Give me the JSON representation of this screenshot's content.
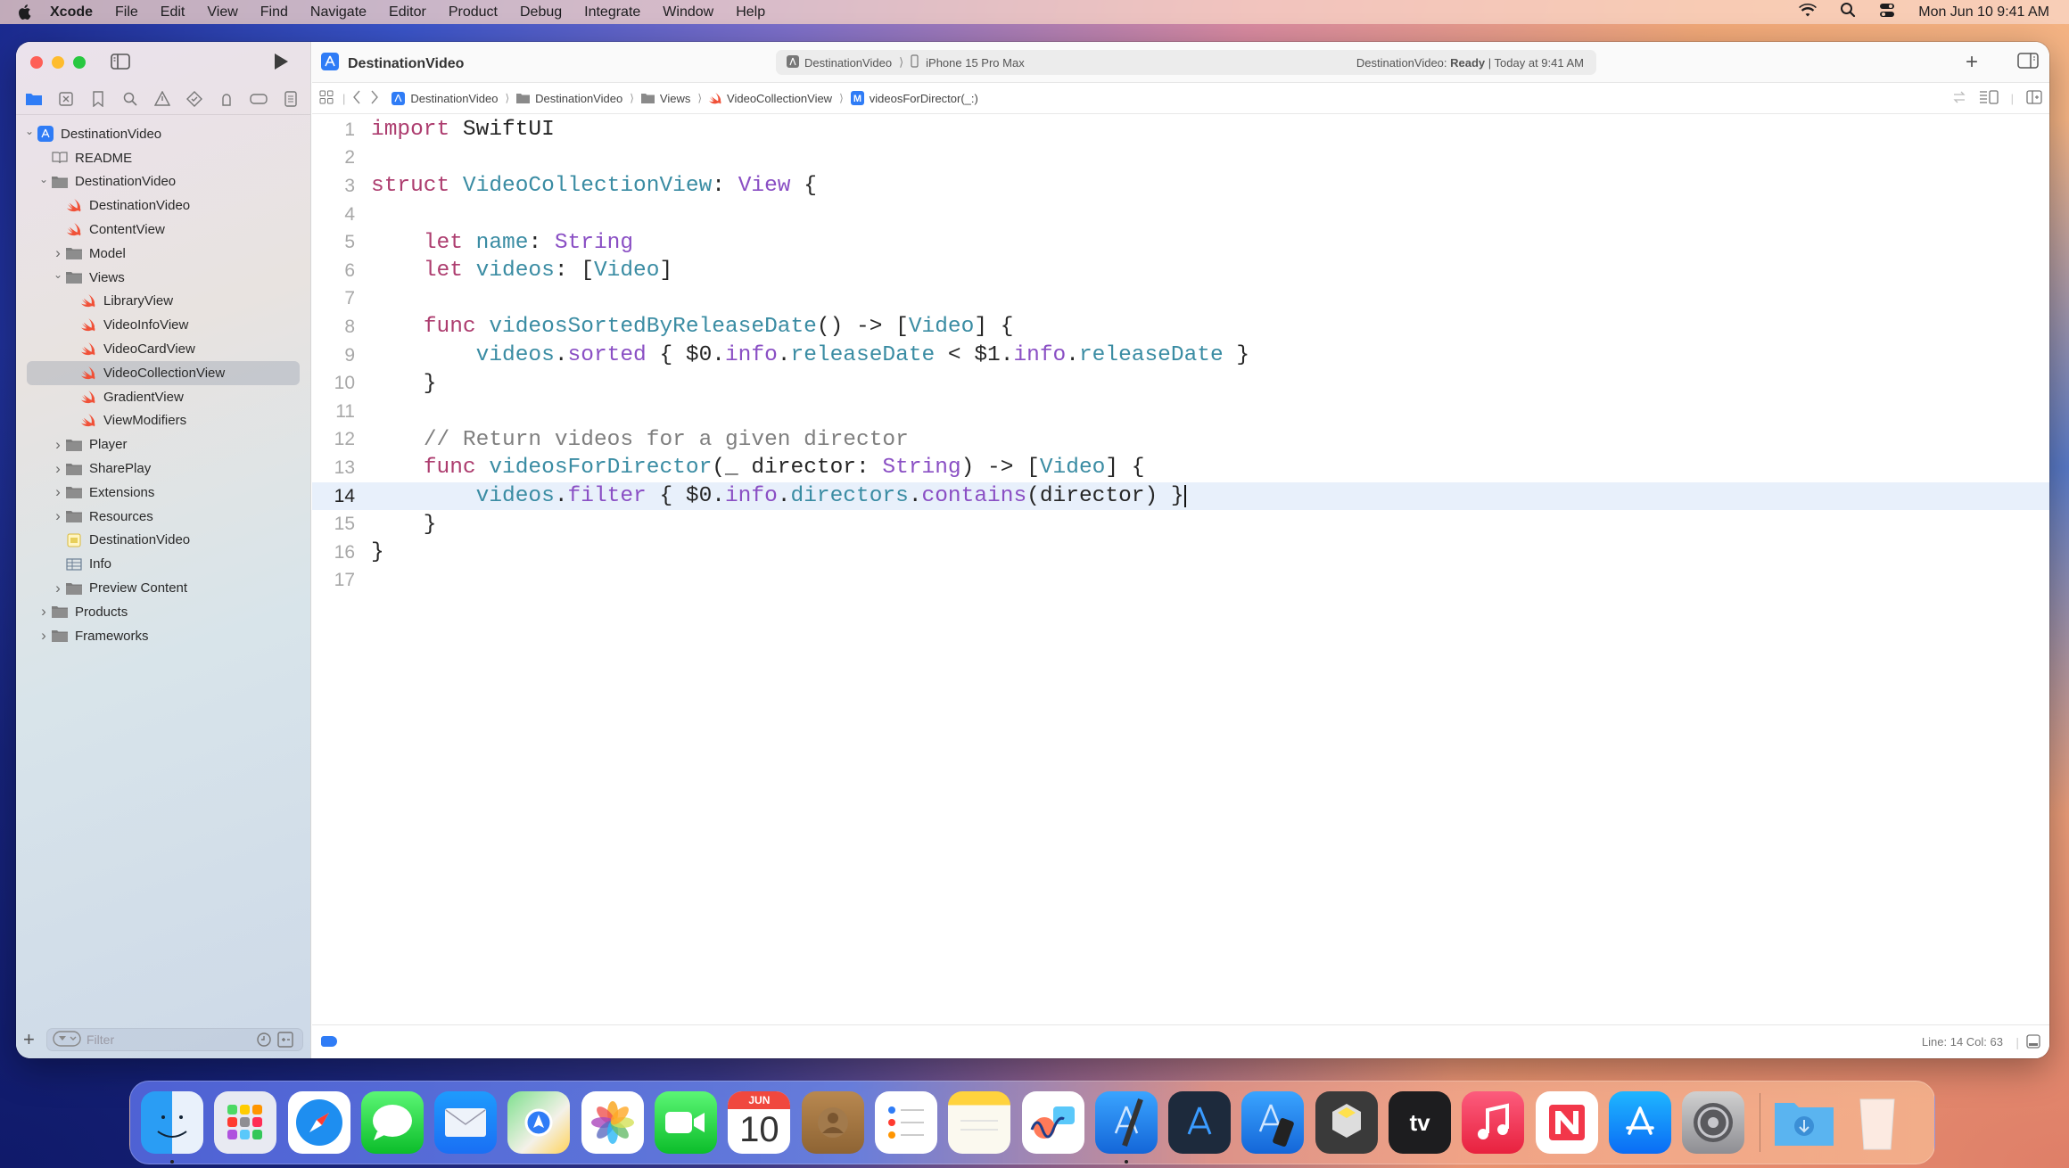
{
  "menubar": {
    "app_name": "Xcode",
    "items": [
      "File",
      "Edit",
      "View",
      "Find",
      "Navigate",
      "Editor",
      "Product",
      "Debug",
      "Integrate",
      "Window",
      "Help"
    ],
    "clock": "Mon Jun 10  9:41 AM"
  },
  "window": {
    "title": "DestinationVideo",
    "scheme": {
      "project": "DestinationVideo",
      "device": "iPhone 15 Pro Max",
      "status_prefix": "DestinationVideo: ",
      "status_bold": "Ready",
      "status_suffix": " | Today at 9:41 AM"
    },
    "breadcrumb": [
      "DestinationVideo",
      "DestinationVideo",
      "Views",
      "VideoCollectionView",
      "videosForDirector(_:)"
    ]
  },
  "navigator": {
    "tree": [
      {
        "label": "DestinationVideo",
        "depth": 0,
        "type": "project",
        "chevron": "open"
      },
      {
        "label": "README",
        "depth": 1,
        "type": "book",
        "chevron": "none"
      },
      {
        "label": "DestinationVideo",
        "depth": 1,
        "type": "folder",
        "chevron": "open"
      },
      {
        "label": "DestinationVideo",
        "depth": 2,
        "type": "swift",
        "chevron": "none"
      },
      {
        "label": "ContentView",
        "depth": 2,
        "type": "swift",
        "chevron": "none"
      },
      {
        "label": "Model",
        "depth": 2,
        "type": "folder",
        "chevron": "closed"
      },
      {
        "label": "Views",
        "depth": 2,
        "type": "folder",
        "chevron": "open"
      },
      {
        "label": "LibraryView",
        "depth": 3,
        "type": "swift",
        "chevron": "none"
      },
      {
        "label": "VideoInfoView",
        "depth": 3,
        "type": "swift",
        "chevron": "none"
      },
      {
        "label": "VideoCardView",
        "depth": 3,
        "type": "swift",
        "chevron": "none"
      },
      {
        "label": "VideoCollectionView",
        "depth": 3,
        "type": "swift",
        "chevron": "none",
        "selected": true
      },
      {
        "label": "GradientView",
        "depth": 3,
        "type": "swift",
        "chevron": "none"
      },
      {
        "label": "ViewModifiers",
        "depth": 3,
        "type": "swift",
        "chevron": "none"
      },
      {
        "label": "Player",
        "depth": 2,
        "type": "folder",
        "chevron": "closed"
      },
      {
        "label": "SharePlay",
        "depth": 2,
        "type": "folder",
        "chevron": "closed"
      },
      {
        "label": "Extensions",
        "depth": 2,
        "type": "folder",
        "chevron": "closed"
      },
      {
        "label": "Resources",
        "depth": 2,
        "type": "folder",
        "chevron": "closed"
      },
      {
        "label": "DestinationVideo",
        "depth": 2,
        "type": "entitlements",
        "chevron": "none"
      },
      {
        "label": "Info",
        "depth": 2,
        "type": "plist",
        "chevron": "none"
      },
      {
        "label": "Preview Content",
        "depth": 2,
        "type": "folder",
        "chevron": "closed"
      },
      {
        "label": "Products",
        "depth": 1,
        "type": "folder",
        "chevron": "closed"
      },
      {
        "label": "Frameworks",
        "depth": 1,
        "type": "folder",
        "chevron": "closed"
      }
    ],
    "filter_placeholder": "Filter"
  },
  "code": {
    "current_line": 14,
    "lines": [
      [
        [
          "kw",
          "import"
        ],
        [
          "pl",
          " SwiftUI"
        ]
      ],
      [],
      [
        [
          "kw",
          "struct"
        ],
        [
          "pl",
          " "
        ],
        [
          "id",
          "VideoCollectionView"
        ],
        [
          "pl",
          ": "
        ],
        [
          "tp",
          "View"
        ],
        [
          "pl",
          " {"
        ]
      ],
      [],
      [
        [
          "pl",
          "    "
        ],
        [
          "kw",
          "let"
        ],
        [
          "pl",
          " "
        ],
        [
          "id",
          "name"
        ],
        [
          "pl",
          ": "
        ],
        [
          "tp",
          "String"
        ]
      ],
      [
        [
          "pl",
          "    "
        ],
        [
          "kw",
          "let"
        ],
        [
          "pl",
          " "
        ],
        [
          "id",
          "videos"
        ],
        [
          "pl",
          ": ["
        ],
        [
          "id",
          "Video"
        ],
        [
          "pl",
          "]"
        ]
      ],
      [],
      [
        [
          "pl",
          "    "
        ],
        [
          "kw",
          "func"
        ],
        [
          "pl",
          " "
        ],
        [
          "id",
          "videosSortedByReleaseDate"
        ],
        [
          "pl",
          "() -> ["
        ],
        [
          "id",
          "Video"
        ],
        [
          "pl",
          "] {"
        ]
      ],
      [
        [
          "pl",
          "        "
        ],
        [
          "id",
          "videos"
        ],
        [
          "pl",
          "."
        ],
        [
          "mt",
          "sorted"
        ],
        [
          "pl",
          " { $0."
        ],
        [
          "mt",
          "info"
        ],
        [
          "pl",
          "."
        ],
        [
          "id",
          "releaseDate"
        ],
        [
          "pl",
          " < $1."
        ],
        [
          "mt",
          "info"
        ],
        [
          "pl",
          "."
        ],
        [
          "id",
          "releaseDate"
        ],
        [
          "pl",
          " }"
        ]
      ],
      [
        [
          "pl",
          "    }"
        ]
      ],
      [],
      [
        [
          "pl",
          "    "
        ],
        [
          "cm",
          "// Return videos for a given director"
        ]
      ],
      [
        [
          "pl",
          "    "
        ],
        [
          "kw",
          "func"
        ],
        [
          "pl",
          " "
        ],
        [
          "id",
          "videosForDirector"
        ],
        [
          "pl",
          "(_ director: "
        ],
        [
          "tp",
          "String"
        ],
        [
          "pl",
          ") -> ["
        ],
        [
          "id",
          "Video"
        ],
        [
          "pl",
          "] {"
        ]
      ],
      [
        [
          "pl",
          "        "
        ],
        [
          "id",
          "videos"
        ],
        [
          "pl",
          "."
        ],
        [
          "mt",
          "filter"
        ],
        [
          "pl",
          " { $0."
        ],
        [
          "mt",
          "info"
        ],
        [
          "pl",
          "."
        ],
        [
          "id",
          "directors"
        ],
        [
          "pl",
          "."
        ],
        [
          "mt",
          "contains"
        ],
        [
          "pl",
          "(director) }"
        ]
      ],
      [
        [
          "pl",
          "    }"
        ]
      ],
      [
        [
          "pl",
          "}"
        ]
      ],
      []
    ]
  },
  "status": {
    "cursor": "Line: 14  Col: 63"
  },
  "dock": {
    "apps": [
      "Finder",
      "Launchpad",
      "Safari",
      "Messages",
      "Mail",
      "Maps",
      "Photos",
      "FaceTime",
      "Calendar",
      "Contacts",
      "Reminders",
      "Notes",
      "Freeform",
      "Xcode",
      "Instruments",
      "Simulator",
      "Reality Composer",
      "TV",
      "Music",
      "News",
      "App Store",
      "System Settings"
    ],
    "calendar_month": "JUN",
    "calendar_day": "10",
    "running": [
      "Finder",
      "Xcode"
    ],
    "others": [
      "Downloads",
      "Trash"
    ]
  },
  "colors": {
    "accent": "#2f7cf6",
    "keyword": "#ad3d6f",
    "type": "#8a4fc4",
    "identifier": "#3a8ca3",
    "comment": "#7f7f7f"
  }
}
